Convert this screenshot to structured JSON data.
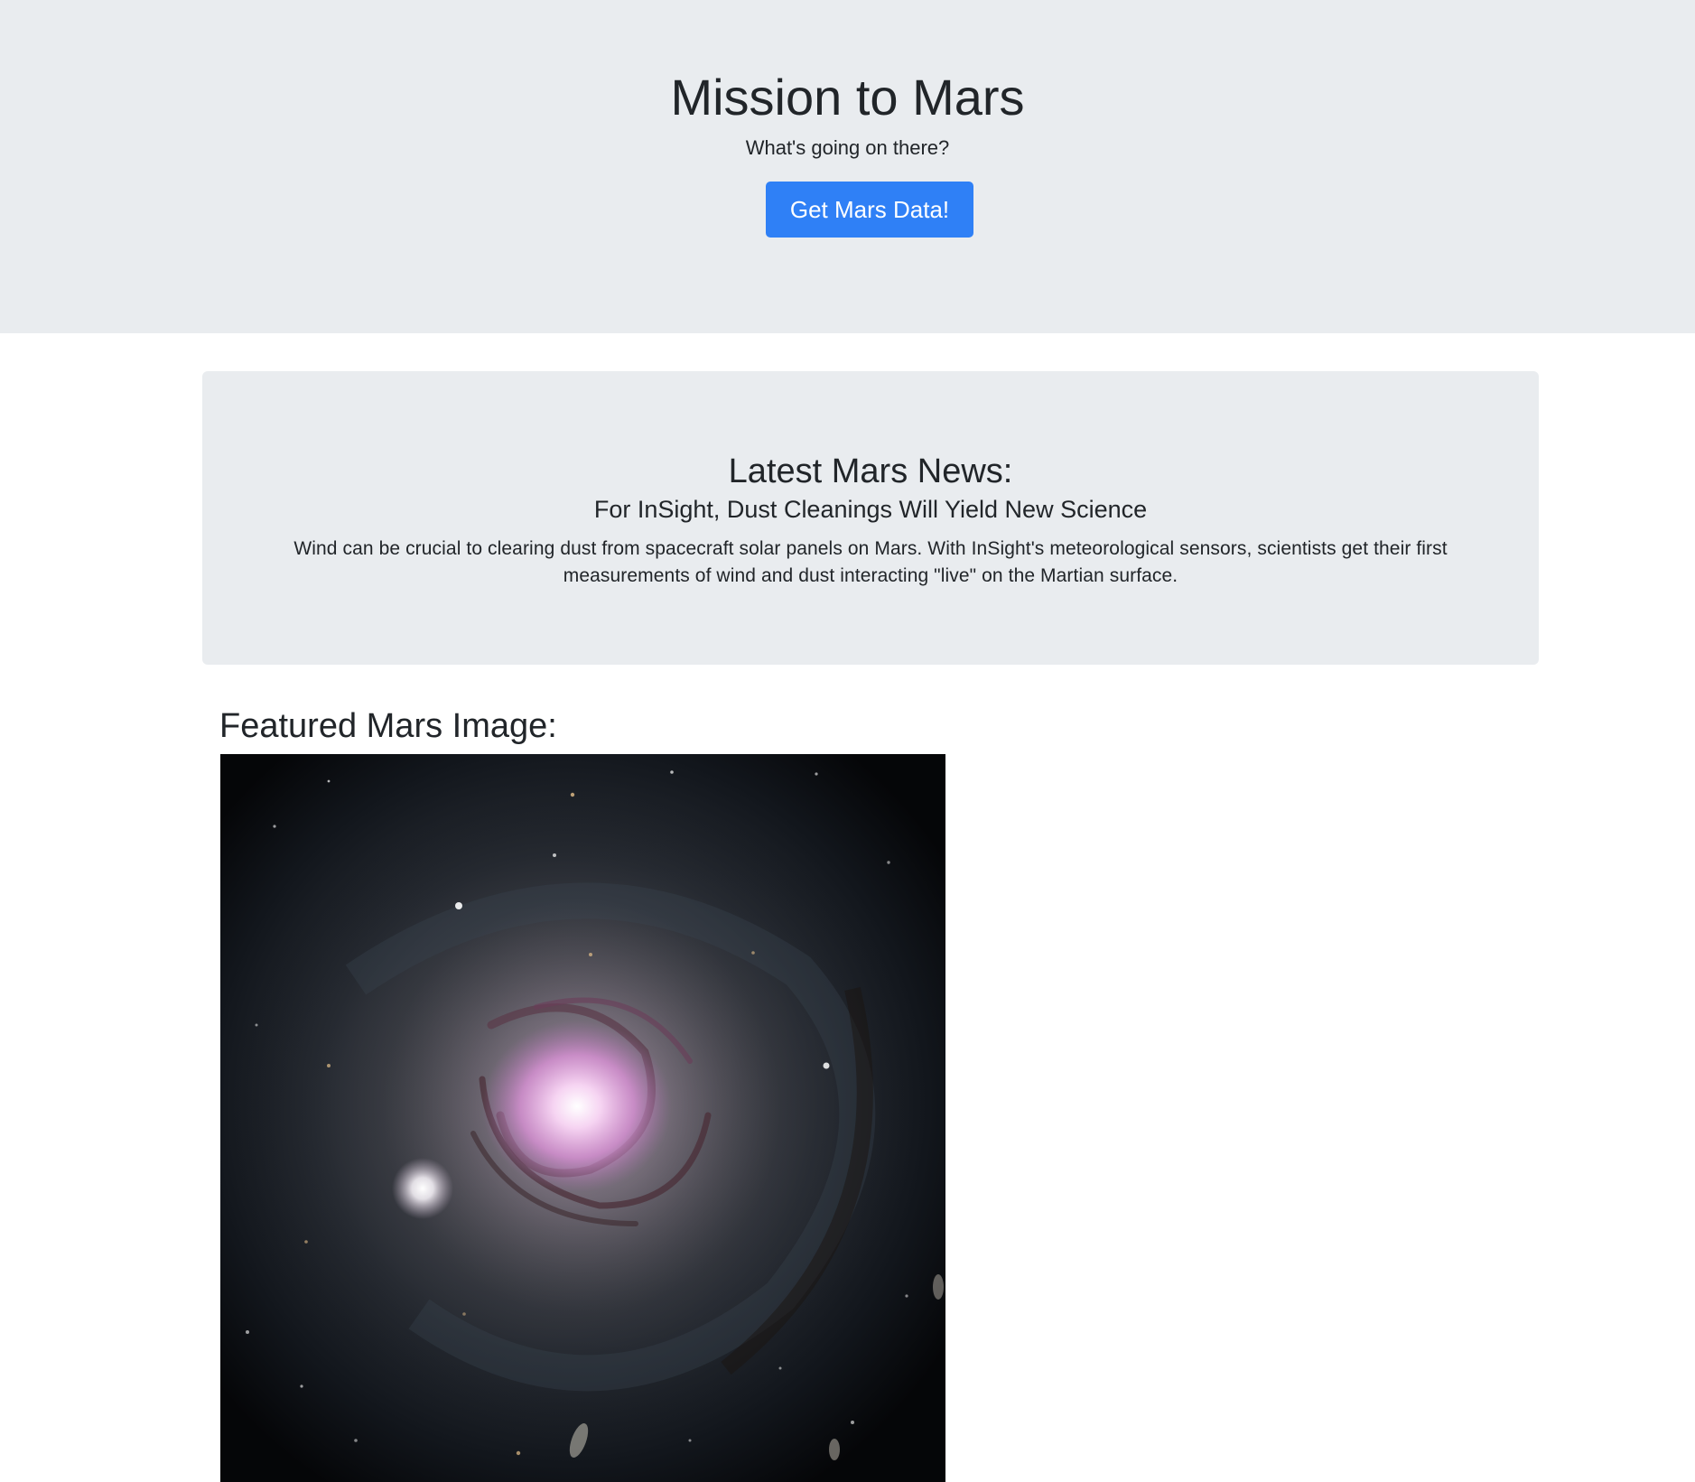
{
  "header": {
    "title": "Mission to Mars",
    "subtitle": "What's going on there?",
    "button_label": "Get Mars Data!"
  },
  "news": {
    "heading": "Latest Mars News:",
    "title": "For InSight, Dust Cleanings Will Yield New Science",
    "paragraph": "Wind can be crucial to clearing dust from spacecraft solar panels on Mars. With InSight's meteorological sensors, scientists get their first measurements of wind and dust interacting \"live\" on the Martian surface."
  },
  "featured": {
    "heading": "Featured Mars Image:",
    "image_subject": "spiral galaxy"
  },
  "colors": {
    "jumbotron_bg": "#e9ecef",
    "button_bg": "#2f80f6",
    "text": "#212529"
  }
}
